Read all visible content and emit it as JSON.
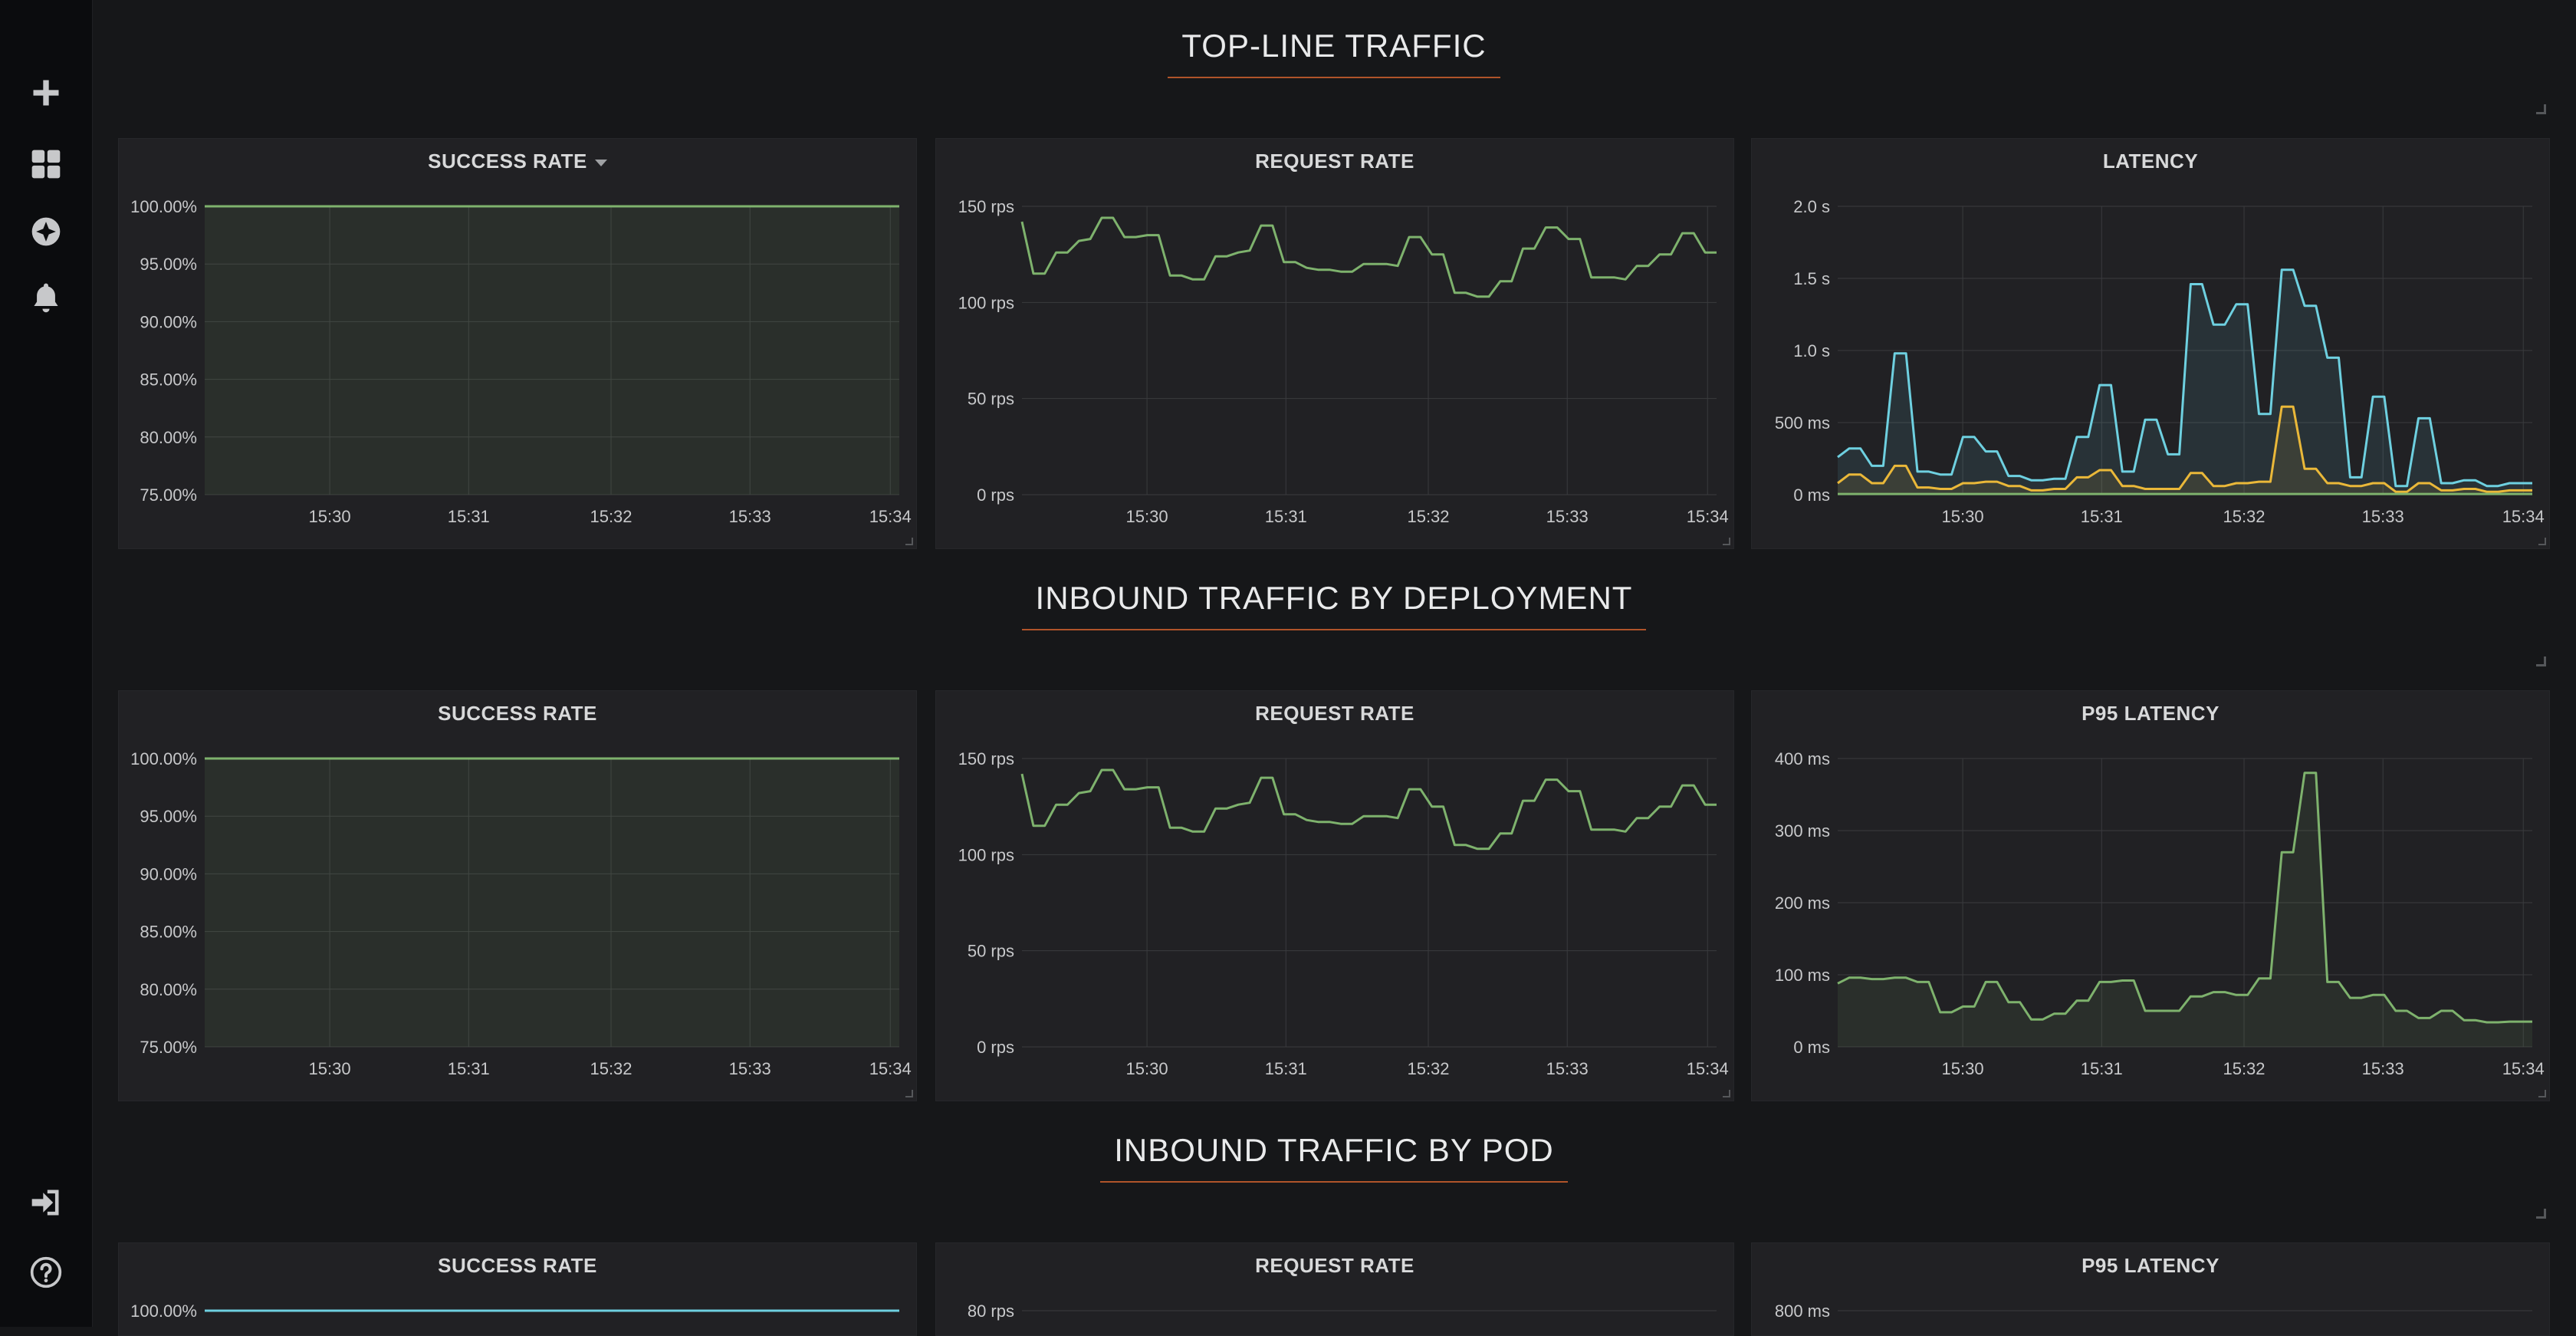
{
  "sidebar": {
    "items": [
      {
        "name": "plus-icon"
      },
      {
        "name": "dashboards-icon"
      },
      {
        "name": "explore-icon"
      },
      {
        "name": "alerting-icon"
      },
      {
        "name": "sign-in-icon"
      },
      {
        "name": "help-icon"
      }
    ]
  },
  "rows": [
    {
      "title": "TOP-LINE TRAFFIC"
    },
    {
      "title": "INBOUND TRAFFIC BY DEPLOYMENT"
    },
    {
      "title": "INBOUND TRAFFIC BY POD"
    }
  ],
  "panels": [
    {
      "title": "SUCCESS RATE"
    },
    {
      "title": "REQUEST RATE"
    },
    {
      "title": "LATENCY"
    },
    {
      "title": "SUCCESS RATE"
    },
    {
      "title": "REQUEST RATE"
    },
    {
      "title": "P95 LATENCY"
    },
    {
      "title": "SUCCESS RATE"
    },
    {
      "title": "REQUEST RATE"
    },
    {
      "title": "P95 LATENCY"
    }
  ],
  "colors": {
    "green": "#7eb26d",
    "blue": "#6ed0e0",
    "yellow": "#eab839",
    "grid": "#3a3b3e",
    "accent": "#b0542a"
  },
  "chart_data": [
    {
      "type": "area",
      "panel": 0,
      "x": [
        "15:30",
        "15:31",
        "15:32",
        "15:33",
        "15:34"
      ],
      "yticks": [
        "75.00%",
        "80.00%",
        "85.00%",
        "90.00%",
        "95.00%",
        "100.00%"
      ],
      "ylim": [
        75,
        100
      ],
      "series": [
        {
          "color": "#7eb26d",
          "fill": true,
          "values": [
            100,
            100,
            100,
            100,
            100,
            100,
            100,
            100,
            100,
            100
          ]
        }
      ]
    },
    {
      "type": "line",
      "panel": 1,
      "x": [
        "15:30",
        "15:31",
        "15:32",
        "15:33",
        "15:34"
      ],
      "yticks": [
        "0 rps",
        "50 rps",
        "100 rps",
        "150 rps"
      ],
      "ylim": [
        0,
        150
      ],
      "series": [
        {
          "color": "#7eb26d",
          "fill": false,
          "values": [
            142,
            115,
            115,
            126,
            126,
            132,
            133,
            144,
            144,
            134,
            134,
            135,
            135,
            114,
            114,
            112,
            112,
            124,
            124,
            126,
            127,
            140,
            140,
            121,
            121,
            118,
            117,
            117,
            116,
            116,
            120,
            120,
            120,
            119,
            134,
            134,
            125,
            125,
            105,
            105,
            103,
            103,
            111,
            111,
            128,
            128,
            139,
            139,
            133,
            133,
            113,
            113,
            113,
            112,
            119,
            119,
            125,
            125,
            136,
            136,
            126,
            126
          ]
        }
      ]
    },
    {
      "type": "area",
      "panel": 2,
      "x": [
        "15:30",
        "15:31",
        "15:32",
        "15:33",
        "15:34"
      ],
      "yticks": [
        "0 ms",
        "500 ms",
        "1.0 s",
        "1.5 s",
        "2.0 s"
      ],
      "ylim": [
        0,
        2000
      ],
      "series": [
        {
          "color": "#6ed0e0",
          "fill": true,
          "values": [
            260,
            320,
            320,
            200,
            200,
            980,
            980,
            160,
            160,
            140,
            140,
            400,
            400,
            300,
            300,
            130,
            130,
            100,
            100,
            110,
            110,
            400,
            400,
            760,
            760,
            160,
            160,
            520,
            520,
            280,
            280,
            1460,
            1460,
            1180,
            1180,
            1320,
            1320,
            560,
            560,
            1560,
            1560,
            1310,
            1310,
            950,
            950,
            120,
            120,
            680,
            680,
            60,
            60,
            530,
            530,
            80,
            80,
            100,
            100,
            60,
            60,
            80,
            80,
            80
          ]
        },
        {
          "color": "#eab839",
          "fill": true,
          "values": [
            80,
            140,
            140,
            80,
            80,
            200,
            200,
            50,
            50,
            40,
            40,
            80,
            80,
            90,
            90,
            60,
            60,
            30,
            30,
            40,
            40,
            120,
            120,
            170,
            170,
            60,
            60,
            40,
            40,
            40,
            40,
            150,
            150,
            60,
            60,
            80,
            80,
            90,
            90,
            610,
            610,
            180,
            180,
            80,
            80,
            60,
            60,
            80,
            80,
            20,
            20,
            80,
            80,
            30,
            30,
            40,
            40,
            20,
            20,
            30,
            30,
            30
          ]
        },
        {
          "color": "#7eb26d",
          "fill": false,
          "values": [
            5,
            5,
            5,
            5,
            5,
            5,
            5,
            5,
            5,
            5,
            5,
            5,
            5,
            5,
            5,
            5,
            5,
            5,
            5,
            5,
            5,
            5,
            5,
            5,
            5,
            5,
            5,
            5,
            5,
            5,
            5,
            5,
            5,
            5,
            5,
            5,
            5,
            5,
            5,
            5,
            5,
            5,
            5,
            5,
            5,
            5,
            5,
            5,
            5,
            5,
            5,
            5,
            5,
            5,
            5,
            5,
            5,
            5,
            5,
            5,
            5,
            5
          ]
        }
      ]
    },
    {
      "type": "area",
      "panel": 3,
      "x": [
        "15:30",
        "15:31",
        "15:32",
        "15:33",
        "15:34"
      ],
      "yticks": [
        "75.00%",
        "80.00%",
        "85.00%",
        "90.00%",
        "95.00%",
        "100.00%"
      ],
      "ylim": [
        75,
        100
      ],
      "series": [
        {
          "color": "#7eb26d",
          "fill": true,
          "values": [
            100,
            100,
            100,
            100,
            100,
            100,
            100,
            100,
            100,
            100
          ]
        }
      ]
    },
    {
      "type": "line",
      "panel": 4,
      "x": [
        "15:30",
        "15:31",
        "15:32",
        "15:33",
        "15:34"
      ],
      "yticks": [
        "0 rps",
        "50 rps",
        "100 rps",
        "150 rps"
      ],
      "ylim": [
        0,
        150
      ],
      "series": [
        {
          "color": "#7eb26d",
          "fill": false,
          "values": [
            142,
            115,
            115,
            126,
            126,
            132,
            133,
            144,
            144,
            134,
            134,
            135,
            135,
            114,
            114,
            112,
            112,
            124,
            124,
            126,
            127,
            140,
            140,
            121,
            121,
            118,
            117,
            117,
            116,
            116,
            120,
            120,
            120,
            119,
            134,
            134,
            125,
            125,
            105,
            105,
            103,
            103,
            111,
            111,
            128,
            128,
            139,
            139,
            133,
            133,
            113,
            113,
            113,
            112,
            119,
            119,
            125,
            125,
            136,
            136,
            126,
            126
          ]
        }
      ]
    },
    {
      "type": "area",
      "panel": 5,
      "x": [
        "15:30",
        "15:31",
        "15:32",
        "15:33",
        "15:34"
      ],
      "yticks": [
        "0 ms",
        "100 ms",
        "200 ms",
        "300 ms",
        "400 ms"
      ],
      "ylim": [
        0,
        400
      ],
      "series": [
        {
          "color": "#7eb26d",
          "fill": true,
          "values": [
            88,
            96,
            96,
            94,
            94,
            96,
            96,
            90,
            90,
            48,
            48,
            56,
            56,
            90,
            90,
            62,
            62,
            38,
            38,
            46,
            46,
            64,
            64,
            90,
            90,
            92,
            92,
            50,
            50,
            50,
            50,
            70,
            70,
            76,
            76,
            72,
            72,
            95,
            95,
            270,
            270,
            380,
            380,
            90,
            90,
            68,
            68,
            72,
            72,
            50,
            50,
            40,
            40,
            50,
            50,
            37,
            37,
            34,
            34,
            35,
            35,
            35
          ]
        }
      ]
    },
    {
      "type": "area",
      "panel": 6,
      "x": [],
      "yticks": [
        "100.00%"
      ],
      "ylim": [
        75,
        100
      ],
      "series": [
        {
          "color": "#6ed0e0",
          "fill": false,
          "values": [
            100,
            100
          ]
        }
      ]
    },
    {
      "type": "line",
      "panel": 7,
      "x": [],
      "yticks": [
        "80 rps"
      ],
      "ylim": [
        0,
        80
      ],
      "series": []
    },
    {
      "type": "line",
      "panel": 8,
      "x": [],
      "yticks": [
        "800 ms"
      ],
      "ylim": [
        0,
        800
      ],
      "series": []
    }
  ]
}
